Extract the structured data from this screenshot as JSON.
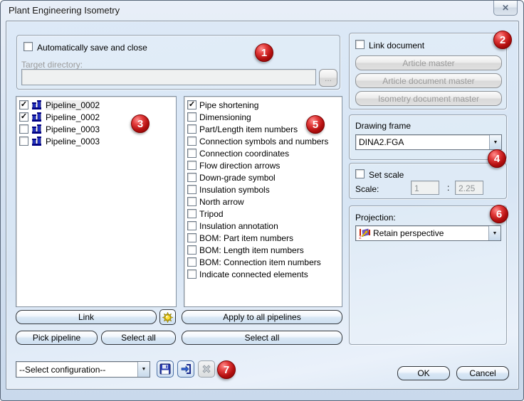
{
  "window": {
    "title": "Plant Engineering Isometry"
  },
  "icons": {
    "close": "✕",
    "combo_arrow": "▼",
    "check": "✓"
  },
  "autosave": {
    "checkbox_label": "Automatically save and close",
    "target_dir_label": "Target directory:",
    "target_dir_value": "",
    "browse_label": "..."
  },
  "link_document": {
    "checkbox_label": "Link document",
    "buttons": [
      "Article master",
      "Article document master",
      "Isometry document master"
    ]
  },
  "pipelines": {
    "items": [
      {
        "label": "Pipeline_0002",
        "checked": true,
        "selected": true
      },
      {
        "label": "Pipeline_0002",
        "checked": true,
        "selected": false
      },
      {
        "label": "Pipeline_0003",
        "checked": false,
        "selected": false
      },
      {
        "label": "Pipeline_0003",
        "checked": false,
        "selected": false
      }
    ]
  },
  "options": {
    "items": [
      {
        "label": "Pipe shortening",
        "checked": true
      },
      {
        "label": "Dimensioning",
        "checked": false
      },
      {
        "label": "Part/Length item numbers",
        "checked": false
      },
      {
        "label": "Connection symbols and numbers",
        "checked": false
      },
      {
        "label": "Connection coordinates",
        "checked": false
      },
      {
        "label": "Flow direction arrows",
        "checked": false
      },
      {
        "label": "Down-grade symbol",
        "checked": false
      },
      {
        "label": "Insulation symbols",
        "checked": false
      },
      {
        "label": "North arrow",
        "checked": false
      },
      {
        "label": "Tripod",
        "checked": false
      },
      {
        "label": "Insulation annotation",
        "checked": false
      },
      {
        "label": "BOM: Part item numbers",
        "checked": false
      },
      {
        "label": "BOM: Length item numbers",
        "checked": false
      },
      {
        "label": "BOM: Connection item numbers",
        "checked": false
      },
      {
        "label": "Indicate connected elements",
        "checked": false
      }
    ]
  },
  "drawing_frame": {
    "label": "Drawing frame",
    "value": "DINA2.FGA"
  },
  "scale": {
    "checkbox_label": "Set scale",
    "label": "Scale:",
    "numerator": "1",
    "separator": ":",
    "denominator": "2.25"
  },
  "projection": {
    "label": "Projection:",
    "value": "Retain perspective"
  },
  "left_buttons": {
    "link": "Link",
    "pick": "Pick pipeline",
    "select_all": "Select all"
  },
  "middle_buttons": {
    "apply_all": "Apply to all pipelines",
    "select_all": "Select all"
  },
  "config": {
    "value": "--Select configuration--"
  },
  "dialog_buttons": {
    "ok": "OK",
    "cancel": "Cancel"
  },
  "annotations": [
    "1",
    "2",
    "3",
    "4",
    "5",
    "6",
    "7"
  ]
}
